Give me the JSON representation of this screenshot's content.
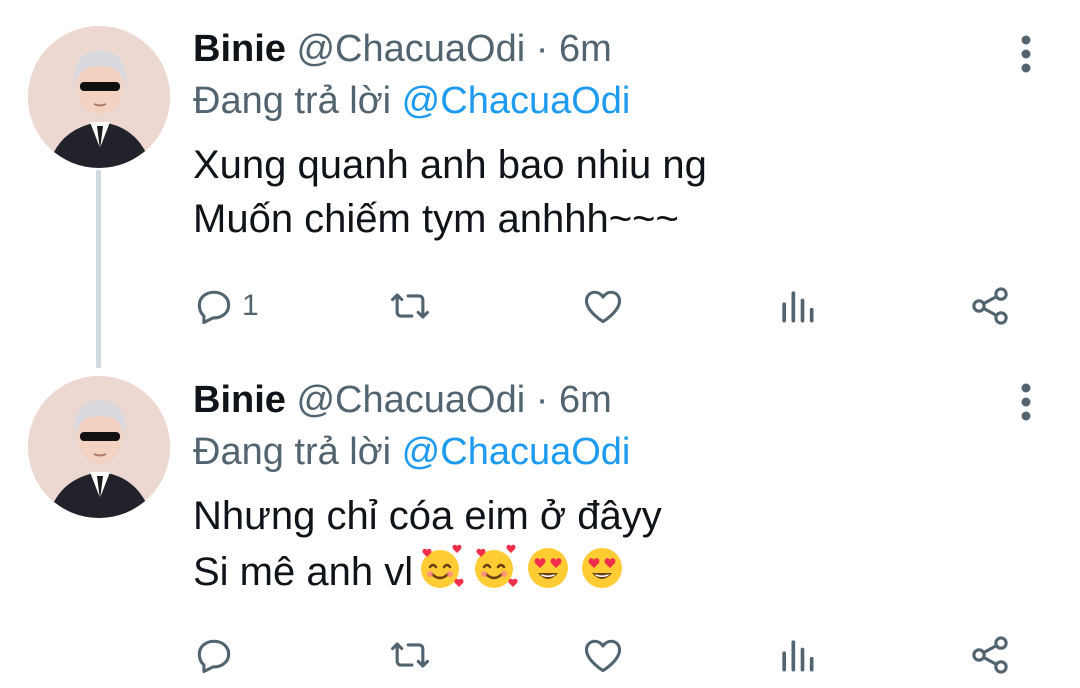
{
  "tweets": [
    {
      "name": "Binie",
      "handle": "@ChacuaOdi",
      "separator": "·",
      "time": "6m",
      "replying_label": "Đang trả lời",
      "replying_to": "@ChacuaOdi",
      "text_lines": [
        "Xung quanh anh bao nhiu ng",
        "Muốn chiếm tym anhhh~~~"
      ],
      "reply_count": "1",
      "emojis": []
    },
    {
      "name": "Binie",
      "handle": "@ChacuaOdi",
      "separator": "·",
      "time": "6m",
      "replying_label": "Đang trả lời",
      "replying_to": "@ChacuaOdi",
      "text_lines": [
        "Nhưng chỉ cóa eim ở đâyy",
        "Si mê anh vl"
      ],
      "reply_count": "",
      "emojis": [
        "smiling-face-with-hearts",
        "smiling-face-with-hearts",
        "heart-eyes",
        "heart-eyes"
      ]
    }
  ],
  "colors": {
    "accent": "#1d9bf0",
    "secondary_text": "#536471",
    "primary_text": "#0f1419",
    "thread_line": "#cfd9de"
  },
  "icons": [
    "reply-icon",
    "retweet-icon",
    "like-icon",
    "analytics-icon",
    "share-icon",
    "more-icon"
  ]
}
